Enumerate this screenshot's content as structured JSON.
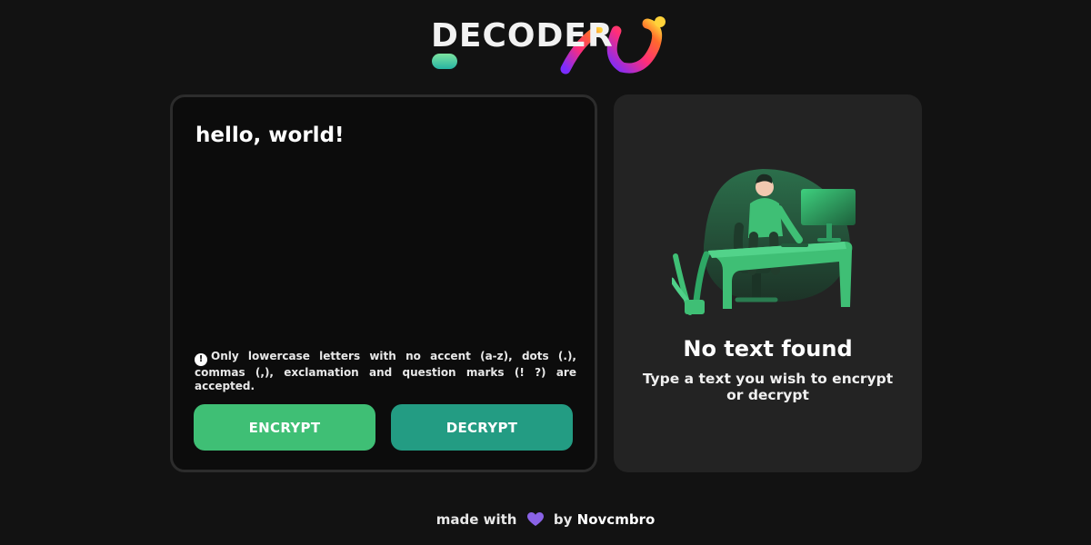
{
  "header": {
    "logo_text": "DECODER"
  },
  "input_panel": {
    "text_value": "hello, world!",
    "notice_icon": "exclamation-circle-icon",
    "notice": "Only lowercase letters with no accent (a-z), dots (.), commas (,), exclamation and question marks (! ?) are accepted.",
    "encrypt_label": "ENCRYPT",
    "decrypt_label": "DECRYPT"
  },
  "output_panel": {
    "illustration": "person-at-computer-illustration",
    "empty_title": "No text found",
    "empty_subtitle": "Type a text you wish to encrypt or decrypt"
  },
  "footer": {
    "prefix": "made with",
    "heart_icon": "heart-icon",
    "by": "by",
    "author": "Novcmbro"
  },
  "colors": {
    "background": "#121212",
    "encrypt_button": "#3fbf75",
    "decrypt_button": "#239c83",
    "output_card": "#232323",
    "heart": "#8a63e6"
  }
}
